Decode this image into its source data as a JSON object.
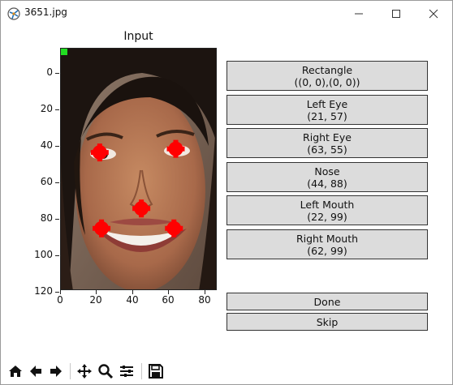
{
  "window": {
    "title": "3651.jpg"
  },
  "plot": {
    "title": "Input",
    "y_ticks": [
      "0",
      "20",
      "40",
      "60",
      "80",
      "100",
      "120"
    ],
    "x_ticks": [
      "0",
      "20",
      "40",
      "60",
      "80"
    ],
    "landmarks": [
      {
        "name": "Left Eye",
        "x": 21,
        "y": 57
      },
      {
        "name": "Right Eye",
        "x": 63,
        "y": 55
      },
      {
        "name": "Nose",
        "x": 44,
        "y": 88
      },
      {
        "name": "Left Mouth",
        "x": 22,
        "y": 99
      },
      {
        "name": "Right Mouth",
        "x": 62,
        "y": 99
      }
    ],
    "marker_color": "#ff0000",
    "rect_marker_color": "#22dd22"
  },
  "buttons": [
    {
      "label": "Rectangle",
      "value": "((0, 0),(0, 0))"
    },
    {
      "label": "Left Eye",
      "value": "(21, 57)"
    },
    {
      "label": "Right Eye",
      "value": "(63, 55)"
    },
    {
      "label": "Nose",
      "value": "(44, 88)"
    },
    {
      "label": "Left Mouth",
      "value": "(22, 99)"
    },
    {
      "label": "Right Mouth",
      "value": "(62, 99)"
    }
  ],
  "done_label": "Done",
  "skip_label": "Skip",
  "toolbar": [
    "home-icon",
    "back-icon",
    "forward-icon",
    "pan-icon",
    "zoom-icon",
    "configure-subplots-icon",
    "save-icon"
  ]
}
